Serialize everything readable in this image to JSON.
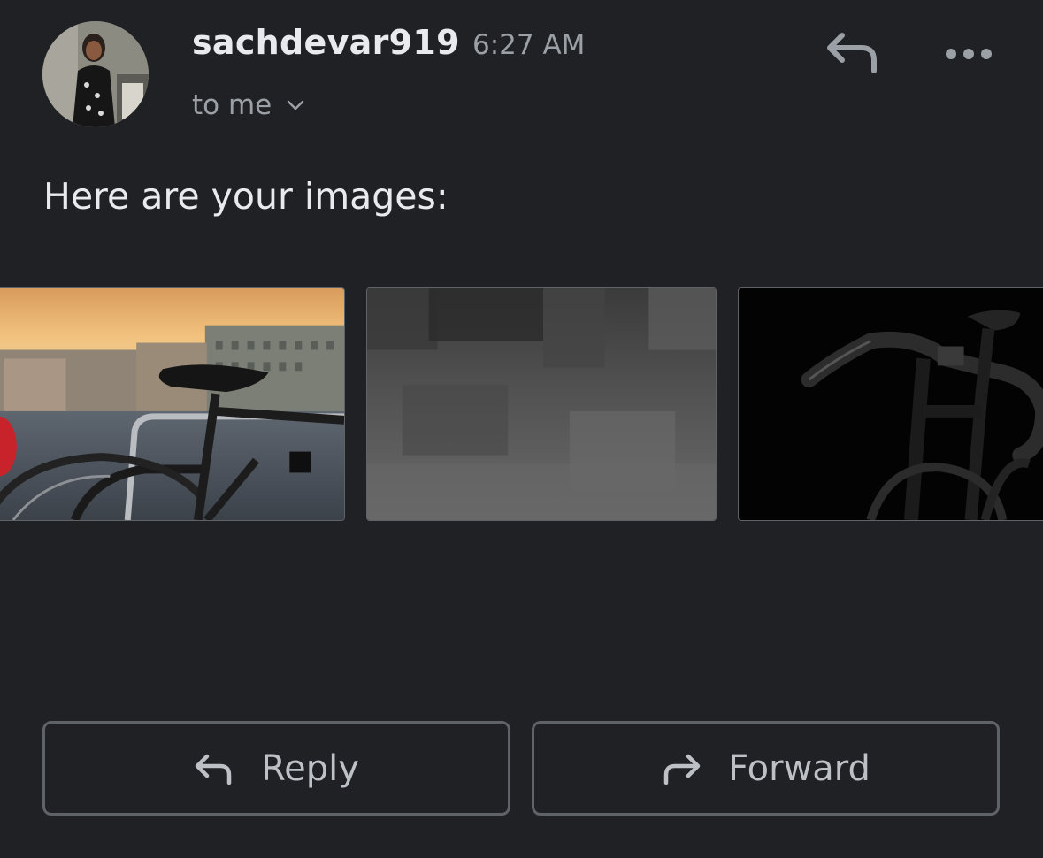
{
  "message": {
    "sender": "sachdevar919",
    "time": "6:27 AM",
    "recipient": "to me",
    "body": "Here are your images:"
  },
  "header_actions": {
    "reply_icon": "reply-icon",
    "more_icon": "more-horizontal-icon"
  },
  "attachments": [
    {
      "description": "bicycle-rear-wheel-city-sunset"
    },
    {
      "description": "loading-placeholder"
    },
    {
      "description": "black-bicycle-dark-background"
    }
  ],
  "actions": {
    "reply_label": "Reply",
    "forward_label": "Forward"
  },
  "colors": {
    "background": "#202124",
    "primary_text": "#e8eaed",
    "secondary_text": "#9aa0a6",
    "button_border": "#5f6368"
  }
}
